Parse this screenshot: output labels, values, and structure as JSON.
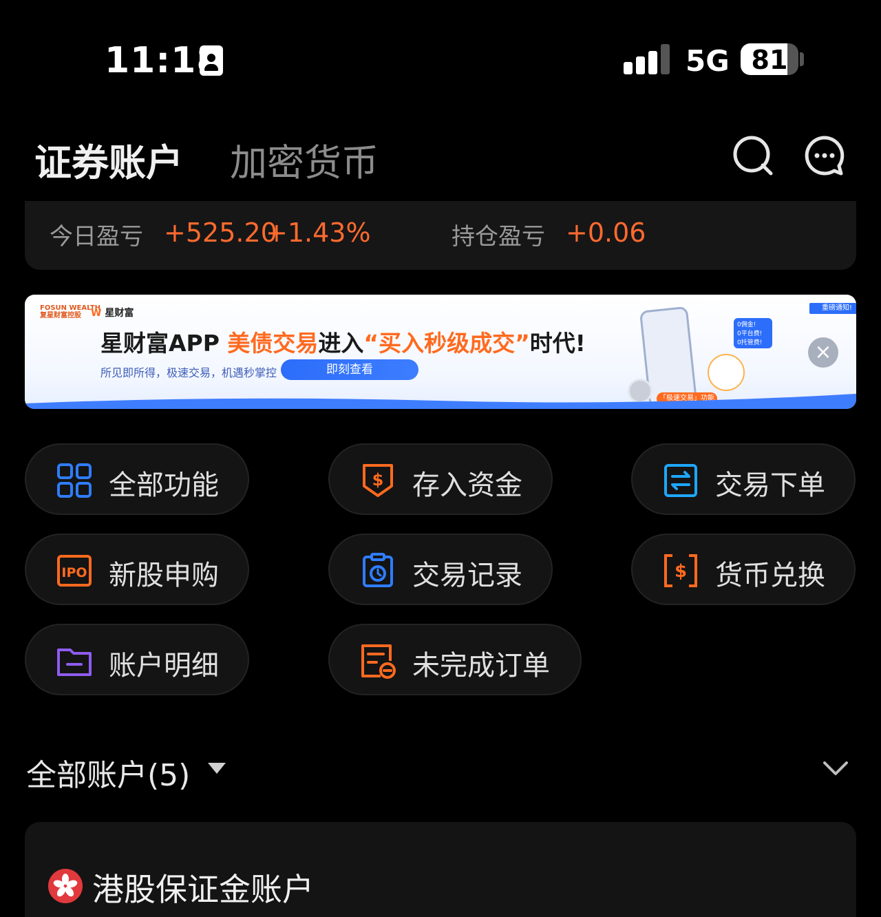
{
  "status_bar": {
    "time": "11:18",
    "network": "5G",
    "battery": "81",
    "battery_level": 0.81
  },
  "header": {
    "tab_active": "证券账户",
    "tab_inactive": "加密货币"
  },
  "summary": {
    "today_label": "今日盈亏",
    "today_amount": "+525.20",
    "today_pct": "+1.43%",
    "position_label": "持仓盈亏",
    "position_amount": "+0.06",
    "accent_color": "#ff6a2f"
  },
  "banner": {
    "brand_line1": "FOSUN WEALTH",
    "brand_line2": "复星财富控股",
    "brand_app": "星财富",
    "title_prefix": "星财富APP ",
    "title_highlight_1": "美债交易",
    "title_mid": "进入",
    "title_highlight_2": "“买入秒级成交”",
    "title_suffix": "时代!",
    "subtitle": "所见即所得，极速交易，机遇秒掌控",
    "cta": "即刻查看",
    "tag": "重磅通知!",
    "bubble": [
      "0佣金!",
      "0平台费!",
      "0托管费!"
    ],
    "phone_tag": "「极速交易」功能"
  },
  "functions": [
    {
      "label": "全部功能",
      "icon": "grid-icon",
      "color": "#2f7dff"
    },
    {
      "label": "存入资金",
      "icon": "deposit-icon",
      "color": "#ff6a1f"
    },
    {
      "label": "交易下单",
      "icon": "trade-icon",
      "color": "#1ea7ff"
    },
    {
      "label": "新股申购",
      "icon": "ipo-icon",
      "color": "#ff6a1f"
    },
    {
      "label": "交易记录",
      "icon": "record-icon",
      "color": "#2f7dff"
    },
    {
      "label": "货币兑换",
      "icon": "exchange-icon",
      "color": "#ff6a1f"
    },
    {
      "label": "账户明细",
      "icon": "folder-icon",
      "color": "#8f5cf0"
    },
    {
      "label": "未完成订单",
      "icon": "pending-order-icon",
      "color": "#ff6a1f"
    }
  ],
  "ipo_icon_text": "IPO",
  "accounts": {
    "title": "全部账户(5)",
    "first_account": "港股保证金账户"
  }
}
